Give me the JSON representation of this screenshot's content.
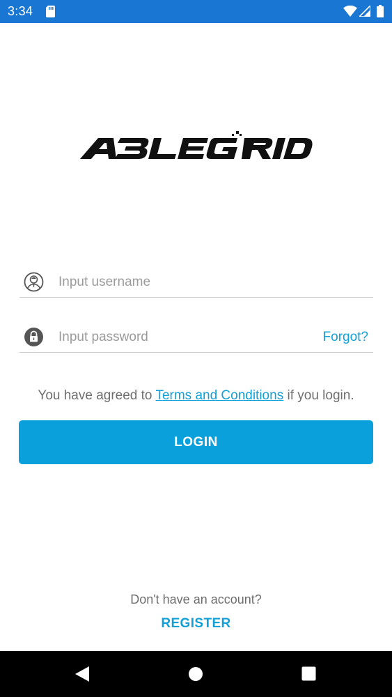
{
  "status_bar": {
    "time": "3:34",
    "icons": [
      "sd-card-icon",
      "wifi-icon",
      "signal-icon",
      "battery-icon"
    ],
    "background": "#1976d2"
  },
  "logo": {
    "text": "ABLEGRID"
  },
  "login_form": {
    "username_placeholder": "Input username",
    "password_placeholder": "Input password",
    "forgot_label": "Forgot?",
    "terms_prefix": "You have agreed to ",
    "terms_link": "Terms and Conditions",
    "terms_suffix": " if you login.",
    "login_label": "LOGIN",
    "accent_color": "#0aa0dc"
  },
  "register": {
    "prompt": "Don't have an account?",
    "link_label": "REGISTER"
  },
  "nav_bar": {
    "icons": [
      "back-icon",
      "home-icon",
      "recents-icon"
    ]
  }
}
